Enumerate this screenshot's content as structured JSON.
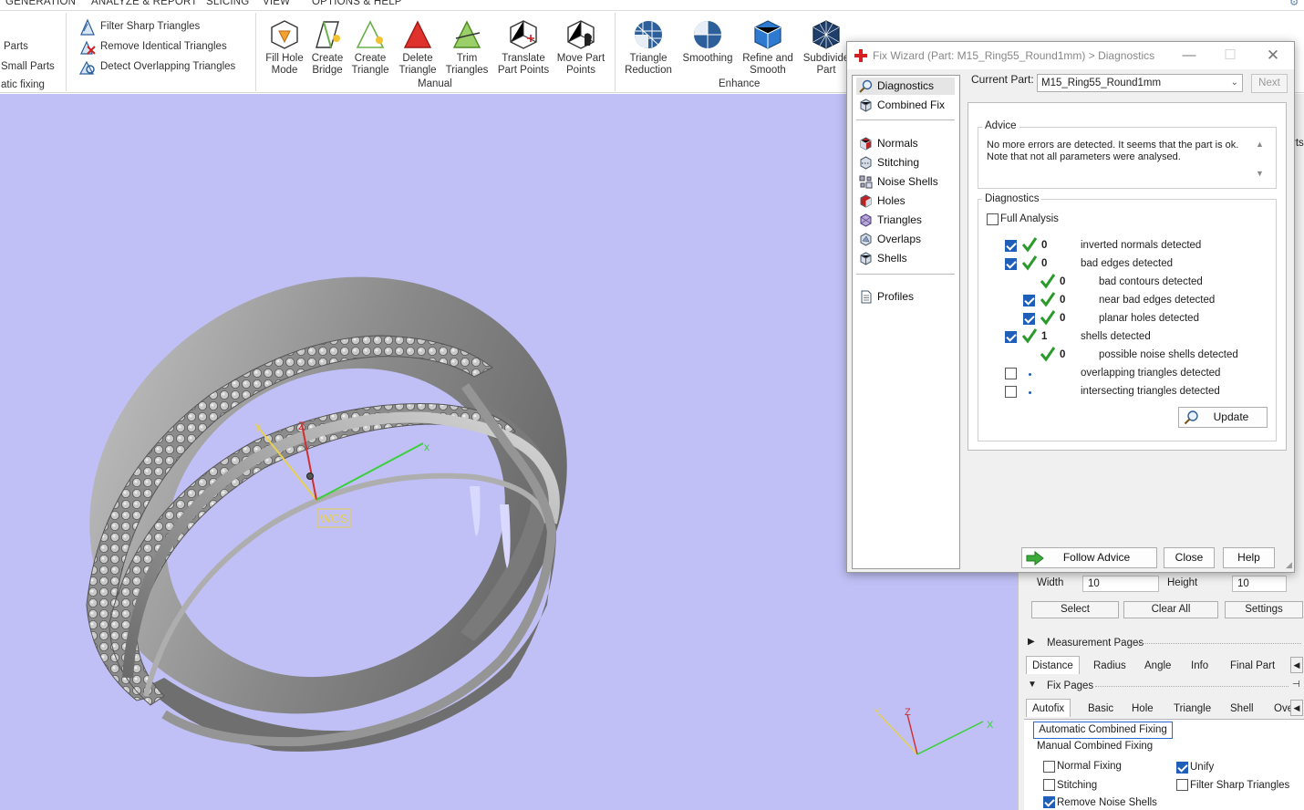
{
  "menu": {
    "items": [
      "GENERATION",
      "ANALYZE & REPORT",
      "SLICING",
      "VIEW",
      "OPTIONS & HELP"
    ]
  },
  "ribbon": {
    "left_items": [
      "Parts",
      "Small Parts",
      "atic fixing"
    ],
    "filter_items": [
      "Filter Sharp Triangles",
      "Remove Identical Triangles",
      "Detect Overlapping Triangles"
    ],
    "manual_buttons": [
      {
        "line1": "Fill Hole",
        "line2": "Mode"
      },
      {
        "line1": "Create",
        "line2": "Bridge"
      },
      {
        "line1": "Create",
        "line2": "Triangle"
      },
      {
        "line1": "Delete",
        "line2": "Triangle"
      },
      {
        "line1": "Trim",
        "line2": "Triangles"
      },
      {
        "line1": "Translate",
        "line2": "Part Points"
      },
      {
        "line1": "Move Part",
        "line2": "Points"
      }
    ],
    "enhance_buttons": [
      {
        "line1": "Triangle",
        "line2": "Reduction"
      },
      {
        "line1": "Smoothing",
        "line2": ""
      },
      {
        "line1": "Refine and",
        "line2": "Smooth"
      },
      {
        "line1": "Subdivide",
        "line2": "Part"
      }
    ],
    "group_manual": "Manual",
    "group_enhance": "Enhance"
  },
  "viewport": {
    "wcs_label": "WCS",
    "axis_x": "x",
    "axis_y": "Y",
    "axis_z": "Z",
    "axis_y_small": "Y",
    "axis_z_small": "Z",
    "axis_x_small": "X"
  },
  "dialog": {
    "title": "Fix Wizard (Part: M15_Ring55_Round1mm) > Diagnostics",
    "nav": [
      {
        "label": "Diagnostics",
        "icon": "magnifier-icon"
      },
      {
        "label": "Combined Fix",
        "icon": "cube-icon"
      },
      {
        "label": "Normals",
        "icon": "normals-icon"
      },
      {
        "label": "Stitching",
        "icon": "stitching-icon"
      },
      {
        "label": "Noise Shells",
        "icon": "noise-shells-icon"
      },
      {
        "label": "Holes",
        "icon": "holes-icon"
      },
      {
        "label": "Triangles",
        "icon": "triangles-icon"
      },
      {
        "label": "Overlaps",
        "icon": "overlaps-icon"
      },
      {
        "label": "Shells",
        "icon": "shells-icon"
      },
      {
        "label": "Profiles",
        "icon": "profiles-icon"
      }
    ],
    "current_part_label": "Current Part:",
    "current_part_value": "M15_Ring55_Round1mm",
    "next_label": "Next",
    "advice_label": "Advice",
    "advice_text": "No more errors are detected. It seems that the part is ok. Note that not all parameters were analysed.",
    "diagnostics_label": "Diagnostics",
    "full_analysis_label": "Full Analysis",
    "rows": [
      {
        "value": "0",
        "label": "inverted normals detected",
        "checked": true,
        "status": "ok"
      },
      {
        "value": "0",
        "label": "bad edges detected",
        "checked": true,
        "status": "ok"
      },
      {
        "value": "0",
        "label": "bad contours detected",
        "checked": null,
        "status": "ok"
      },
      {
        "value": "0",
        "label": "near bad edges detected",
        "checked": true,
        "status": "ok"
      },
      {
        "value": "0",
        "label": "planar holes detected",
        "checked": true,
        "status": "ok"
      },
      {
        "value": "1",
        "label": "shells detected",
        "checked": true,
        "status": "ok"
      },
      {
        "value": "0",
        "label": "possible noise shells detected",
        "checked": null,
        "status": "ok"
      },
      {
        "value": "",
        "label": "overlapping triangles detected",
        "checked": false,
        "status": "none"
      },
      {
        "value": "",
        "label": "intersecting triangles detected",
        "checked": false,
        "status": "none"
      }
    ],
    "update_label": "Update",
    "follow_advice_label": "Follow Advice",
    "close_label": "Close",
    "help_label": "Help"
  },
  "rightpanel": {
    "width_label": "Width",
    "width_value": "10",
    "height_label": "Height",
    "height_value": "10",
    "select_label": "Select",
    "clear_all_label": "Clear All",
    "settings_label": "Settings",
    "measurement_pages_label": "Measurement Pages",
    "measurement_tabs": [
      "Distance",
      "Radius",
      "Angle",
      "Info",
      "Final Part"
    ],
    "fix_pages_label": "Fix Pages",
    "fix_tabs": [
      "Autofix",
      "Basic",
      "Hole",
      "Triangle",
      "Shell",
      "Over"
    ],
    "auto_combined_label": "Automatic Combined Fixing",
    "manual_combined_label": "Manual Combined Fixing",
    "options": [
      {
        "label": "Normal Fixing",
        "checked": false
      },
      {
        "label": "Unify",
        "checked": true
      },
      {
        "label": "Stitching",
        "checked": false
      },
      {
        "label": "Filter Sharp Triangles",
        "checked": false
      },
      {
        "label": "Remove Noise Shells",
        "checked": true
      }
    ],
    "edge_label": "rts"
  }
}
